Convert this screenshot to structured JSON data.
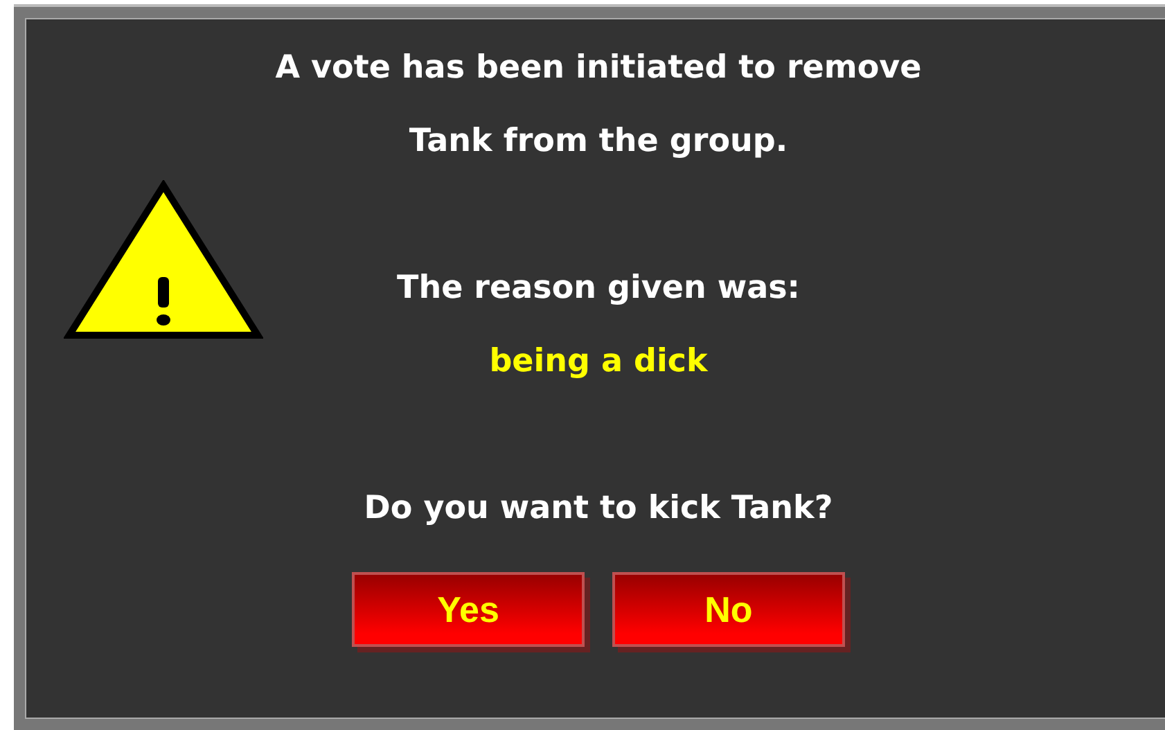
{
  "dialog": {
    "message_lines": [
      "A vote has been initiated to remove",
      "Tank from the group."
    ],
    "reason_label": "The reason given was:",
    "reason": "being a dick",
    "question": "Do you want to kick Tank?",
    "buttons": [
      {
        "label": "Yes"
      },
      {
        "label": "No"
      }
    ]
  }
}
